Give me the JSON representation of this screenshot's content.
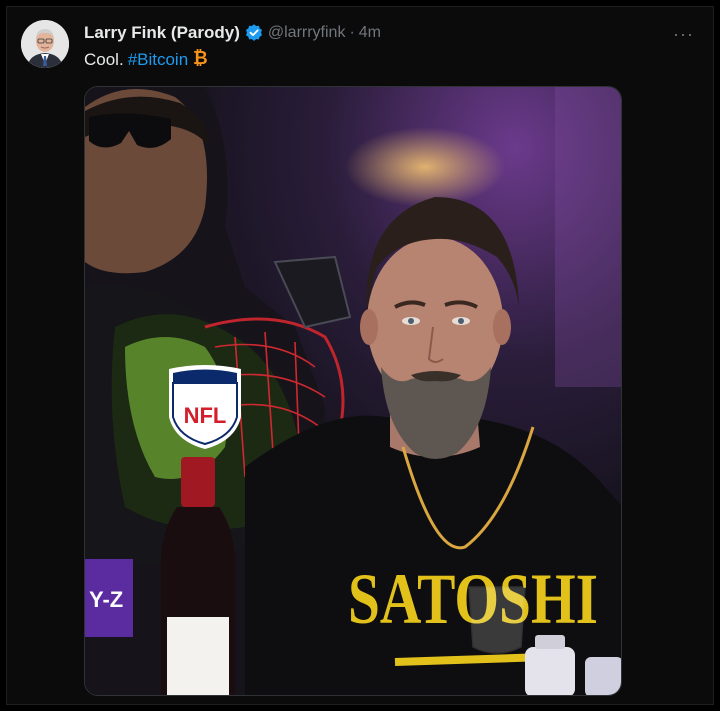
{
  "tweet": {
    "display_name": "Larry Fink (Parody)",
    "handle": "@larrryfink",
    "separator": "·",
    "time": "4m",
    "text": "Cool.",
    "hashtag": "#Bitcoin",
    "more_label": "···"
  },
  "media": {
    "shirt_text": "SATOSHI",
    "shield_text": "NFL",
    "sign_text": "Y-Z"
  },
  "colors": {
    "background": "#000000",
    "text_primary": "#e7e9ea",
    "text_secondary": "#71767b",
    "link": "#1d9bf0",
    "verified": "#1d9bf0",
    "bitcoin": "#f7931a",
    "shirt_print": "#e2c21a"
  },
  "icons": [
    "verified-badge-icon",
    "more-options-icon",
    "bitcoin-icon"
  ]
}
